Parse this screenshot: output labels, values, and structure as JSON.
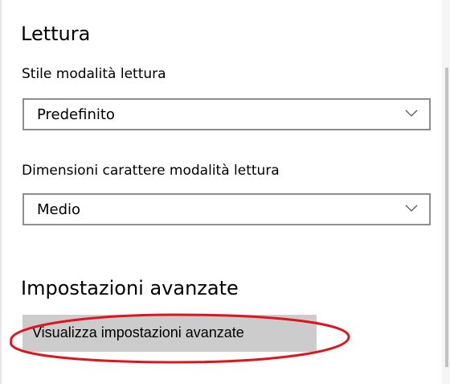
{
  "reading": {
    "title": "Lettura",
    "style_label": "Stile modalità lettura",
    "style_value": "Predefinito",
    "font_size_label": "Dimensioni carattere modalità lettura",
    "font_size_value": "Medio"
  },
  "advanced": {
    "title": "Impostazioni avanzate",
    "button_label": "Visualizza impostazioni avanzate"
  },
  "icons": {
    "dropdown": "chevron-down-icon"
  },
  "colors": {
    "button_bg": "#cccccc",
    "select_border": "#8e8e8e",
    "highlight": "#e0141e"
  }
}
